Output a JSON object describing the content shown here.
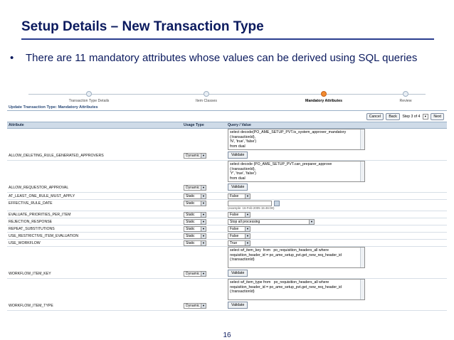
{
  "slide": {
    "title": "Setup Details – New Transaction Type",
    "bullet": "There are 11 mandatory attributes whose values can be derived using SQL queries",
    "page_number": "16",
    "bullet_glyph": "•"
  },
  "train": [
    {
      "label": "Transaction Type Details",
      "active": false
    },
    {
      "label": "Item Classes",
      "active": false
    },
    {
      "label": "Mandatory Attributes",
      "active": true
    },
    {
      "label": "Review",
      "active": false
    }
  ],
  "page": {
    "heading": "Update Transaction Type: Mandatory Attributes",
    "buttons": {
      "cancel": "Cancel",
      "back": "Back",
      "step": "Step 3 of 4",
      "next": "Next"
    }
  },
  "table": {
    "headers": {
      "attribute": "Attribute",
      "usage": "Usage Type",
      "query": "Query / Value"
    },
    "validate_label": "Validate",
    "example_text": "(example: 16-Feb-2005 15:46:00)",
    "rows": {
      "r0": {
        "attribute": "ALLOW_DELETING_RULE_GENERATED_APPROVERS",
        "usage": "Dynamic",
        "query": "select decode(PO_AME_SETUP_PVT.is_system_approver_mandatory\n(:transactionId),\n'N', 'true', 'false')\nfrom dual"
      },
      "r1": {
        "attribute": "ALLOW_REQUESTOR_APPROVAL",
        "usage": "Dynamic",
        "query": "select decode (PO_AME_SETUP_PVT.can_preparer_approve\n(:transactionId),\n'Y', 'true', 'false')\nfrom dual"
      },
      "r2": {
        "attribute": "AT_LEAST_ONE_RULE_MUST_APPLY",
        "usage": "Static",
        "value": "False"
      },
      "r3": {
        "attribute": "EFFECTIVE_RULE_DATE",
        "usage": "Static"
      },
      "r4": {
        "attribute": "EVALUATE_PRIORITIES_PER_ITEM",
        "usage": "Static",
        "value": "False"
      },
      "r5": {
        "attribute": "REJECTION_RESPONSE",
        "usage": "Static",
        "value": "Stop all processing"
      },
      "r6": {
        "attribute": "REPEAT_SUBSTITUTIONS",
        "usage": "Static",
        "value": "False"
      },
      "r7": {
        "attribute": "USE_RESTRICTIVE_ITEM_EVALUATION",
        "usage": "Static",
        "value": "False"
      },
      "r8": {
        "attribute": "USE_WORKFLOW",
        "usage": "Static",
        "value": "True"
      },
      "r9": {
        "attribute": "WORKFLOW_ITEM_KEY",
        "usage": "Dynamic",
        "query": "select wf_item_key  from   po_requisition_headers_all where\nrequisition_header_id = po_ame_setup_pvt.get_new_req_header_id\n(:transactionId)"
      },
      "r10": {
        "attribute": "WORKFLOW_ITEM_TYPE",
        "usage": "Dynamic",
        "query": "select wf_item_type from   po_requisition_headers_all where\nrequisition_header_id = po_ame_setup_pvt.get_new_req_header_id\n(:transactionId)"
      }
    }
  },
  "colors": {
    "title": "#0b1a5e",
    "header_bg": "#cfdbe8",
    "active_step": "#f28a2e"
  },
  "icons": [
    "dropdown-arrow-icon",
    "calendar-icon",
    "train-step-icon"
  ]
}
